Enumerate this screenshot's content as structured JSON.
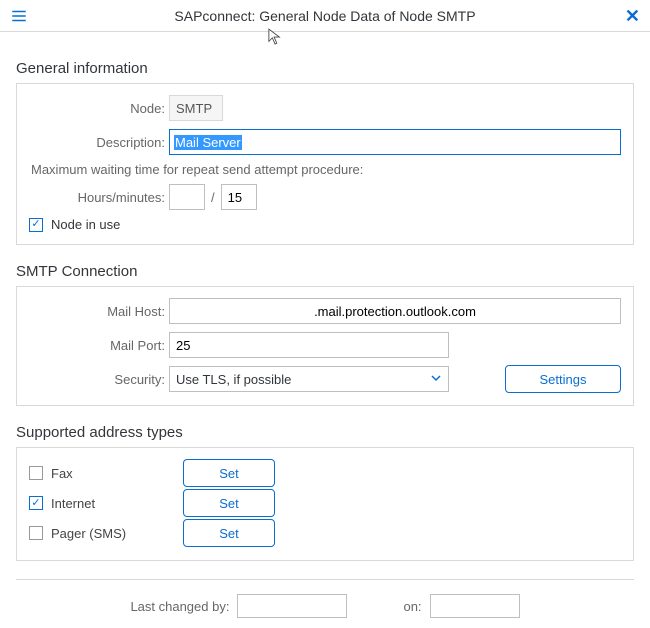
{
  "header": {
    "title": "SAPconnect: General Node Data of Node SMTP"
  },
  "sections": {
    "general": {
      "title": "General information",
      "node_label": "Node:",
      "node_value": "SMTP",
      "description_label": "Description:",
      "description_value": "Mail Server",
      "waiting_text": "Maximum waiting time for repeat send attempt procedure:",
      "hoursmin_label": "Hours/minutes:",
      "hours_value": "",
      "minutes_value": "15",
      "slash": "/",
      "node_in_use_label": "Node in use",
      "node_in_use_checked": true
    },
    "smtp": {
      "title": "SMTP Connection",
      "mailhost_label": "Mail Host:",
      "mailhost_value": ".mail.protection.outlook.com",
      "mailport_label": "Mail Port:",
      "mailport_value": "25",
      "security_label": "Security:",
      "security_value": "Use TLS, if possible",
      "settings_button": "Settings"
    },
    "addr": {
      "title": "Supported address types",
      "items": [
        {
          "label": "Fax",
          "checked": false,
          "button": "Set"
        },
        {
          "label": "Internet",
          "checked": true,
          "button": "Set"
        },
        {
          "label": "Pager (SMS)",
          "checked": false,
          "button": "Set"
        }
      ]
    },
    "footer": {
      "changed_by_label": "Last changed by:",
      "changed_by_value": "",
      "on_label": "on:",
      "on_value": ""
    }
  }
}
